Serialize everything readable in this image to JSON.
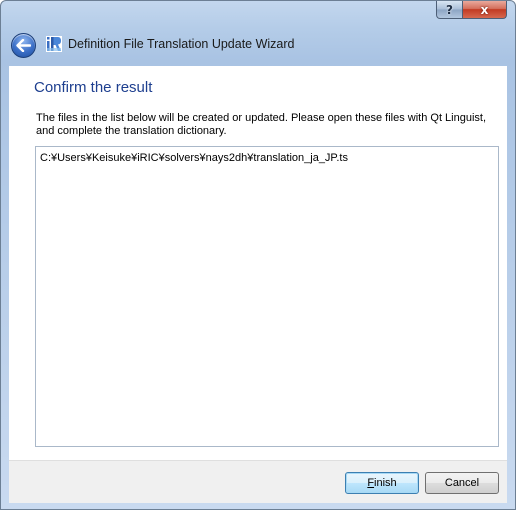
{
  "window": {
    "title": "Definition File Translation Update Wizard",
    "help_label": "?",
    "close_label": "x"
  },
  "page": {
    "title": "Confirm the result",
    "description": "The files in the list below will be created or updated. Please open these files with Qt Linguist, and complete the translation dictionary.",
    "files": [
      "C:¥Users¥Keisuke¥iRIC¥solvers¥nays2dh¥translation_ja_JP.ts"
    ]
  },
  "buttons": {
    "finish_label": "Finish",
    "cancel_label": "Cancel"
  },
  "colors": {
    "title_accent": "#1e3f8f",
    "default_button_border": "#3c7fb1",
    "close_button": "#c23a22"
  },
  "icons": {
    "back": "back-arrow-icon",
    "app": "iric-app-icon"
  }
}
